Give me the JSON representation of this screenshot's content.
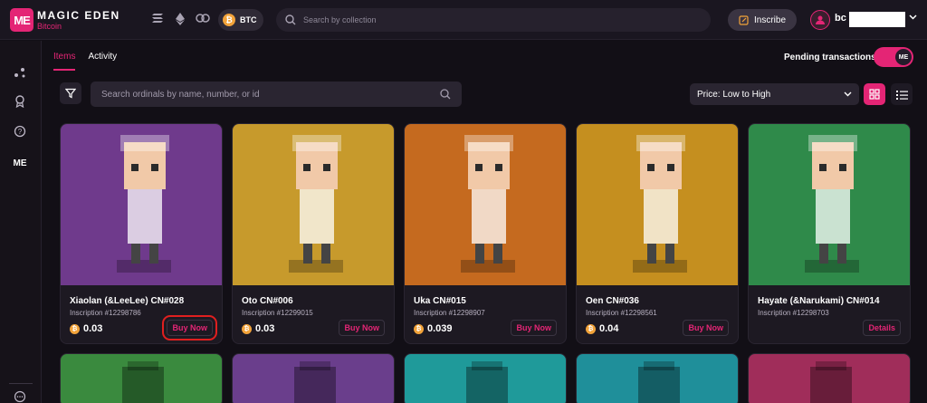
{
  "header": {
    "brand": "MAGIC EDEN",
    "brand_sub": "Bitcoin",
    "logo_text": "ME",
    "chain": "BTC",
    "search_placeholder": "Search by collection",
    "inscribe_label": "Inscribe",
    "wallet_prefix": "bc"
  },
  "tabs": [
    {
      "label": "Items",
      "active": true
    },
    {
      "label": "Activity",
      "active": false
    }
  ],
  "pending": {
    "label": "Pending transactions",
    "on": true,
    "knob_text": "ME"
  },
  "toolbar": {
    "search_placeholder": "Search ordinals by name, number, or id",
    "sort_value": "Price: Low to High"
  },
  "items": [
    {
      "name": "Xiaolan (&LeeLee) CN#028",
      "inscription": "Inscription #12298786",
      "price": "0.03",
      "action": "Buy Now",
      "bg": "#6f3a8c",
      "highlight": true
    },
    {
      "name": "Oto CN#006",
      "inscription": "Inscription #12299015",
      "price": "0.03",
      "action": "Buy Now",
      "bg": "#c79a2c",
      "highlight": false
    },
    {
      "name": "Uka CN#015",
      "inscription": "Inscription #12298907",
      "price": "0.039",
      "action": "Buy Now",
      "bg": "#c56a1f",
      "highlight": false
    },
    {
      "name": "Oen CN#036",
      "inscription": "Inscription #12298561",
      "price": "0.04",
      "action": "Buy Now",
      "bg": "#c58f1f",
      "highlight": false
    },
    {
      "name": "Hayate (&Narukami) CN#014",
      "inscription": "Inscription #12298703",
      "price": "",
      "action": "Details",
      "bg": "#2f8a4a",
      "highlight": false
    }
  ],
  "row2_bgs": [
    "#3a8a3e",
    "#6a3e8c",
    "#1f9a9a",
    "#1f8f9a",
    "#a02d5a"
  ],
  "colors": {
    "accent": "#e42575",
    "bg": "#120f16",
    "btc": "#f2a33a"
  }
}
